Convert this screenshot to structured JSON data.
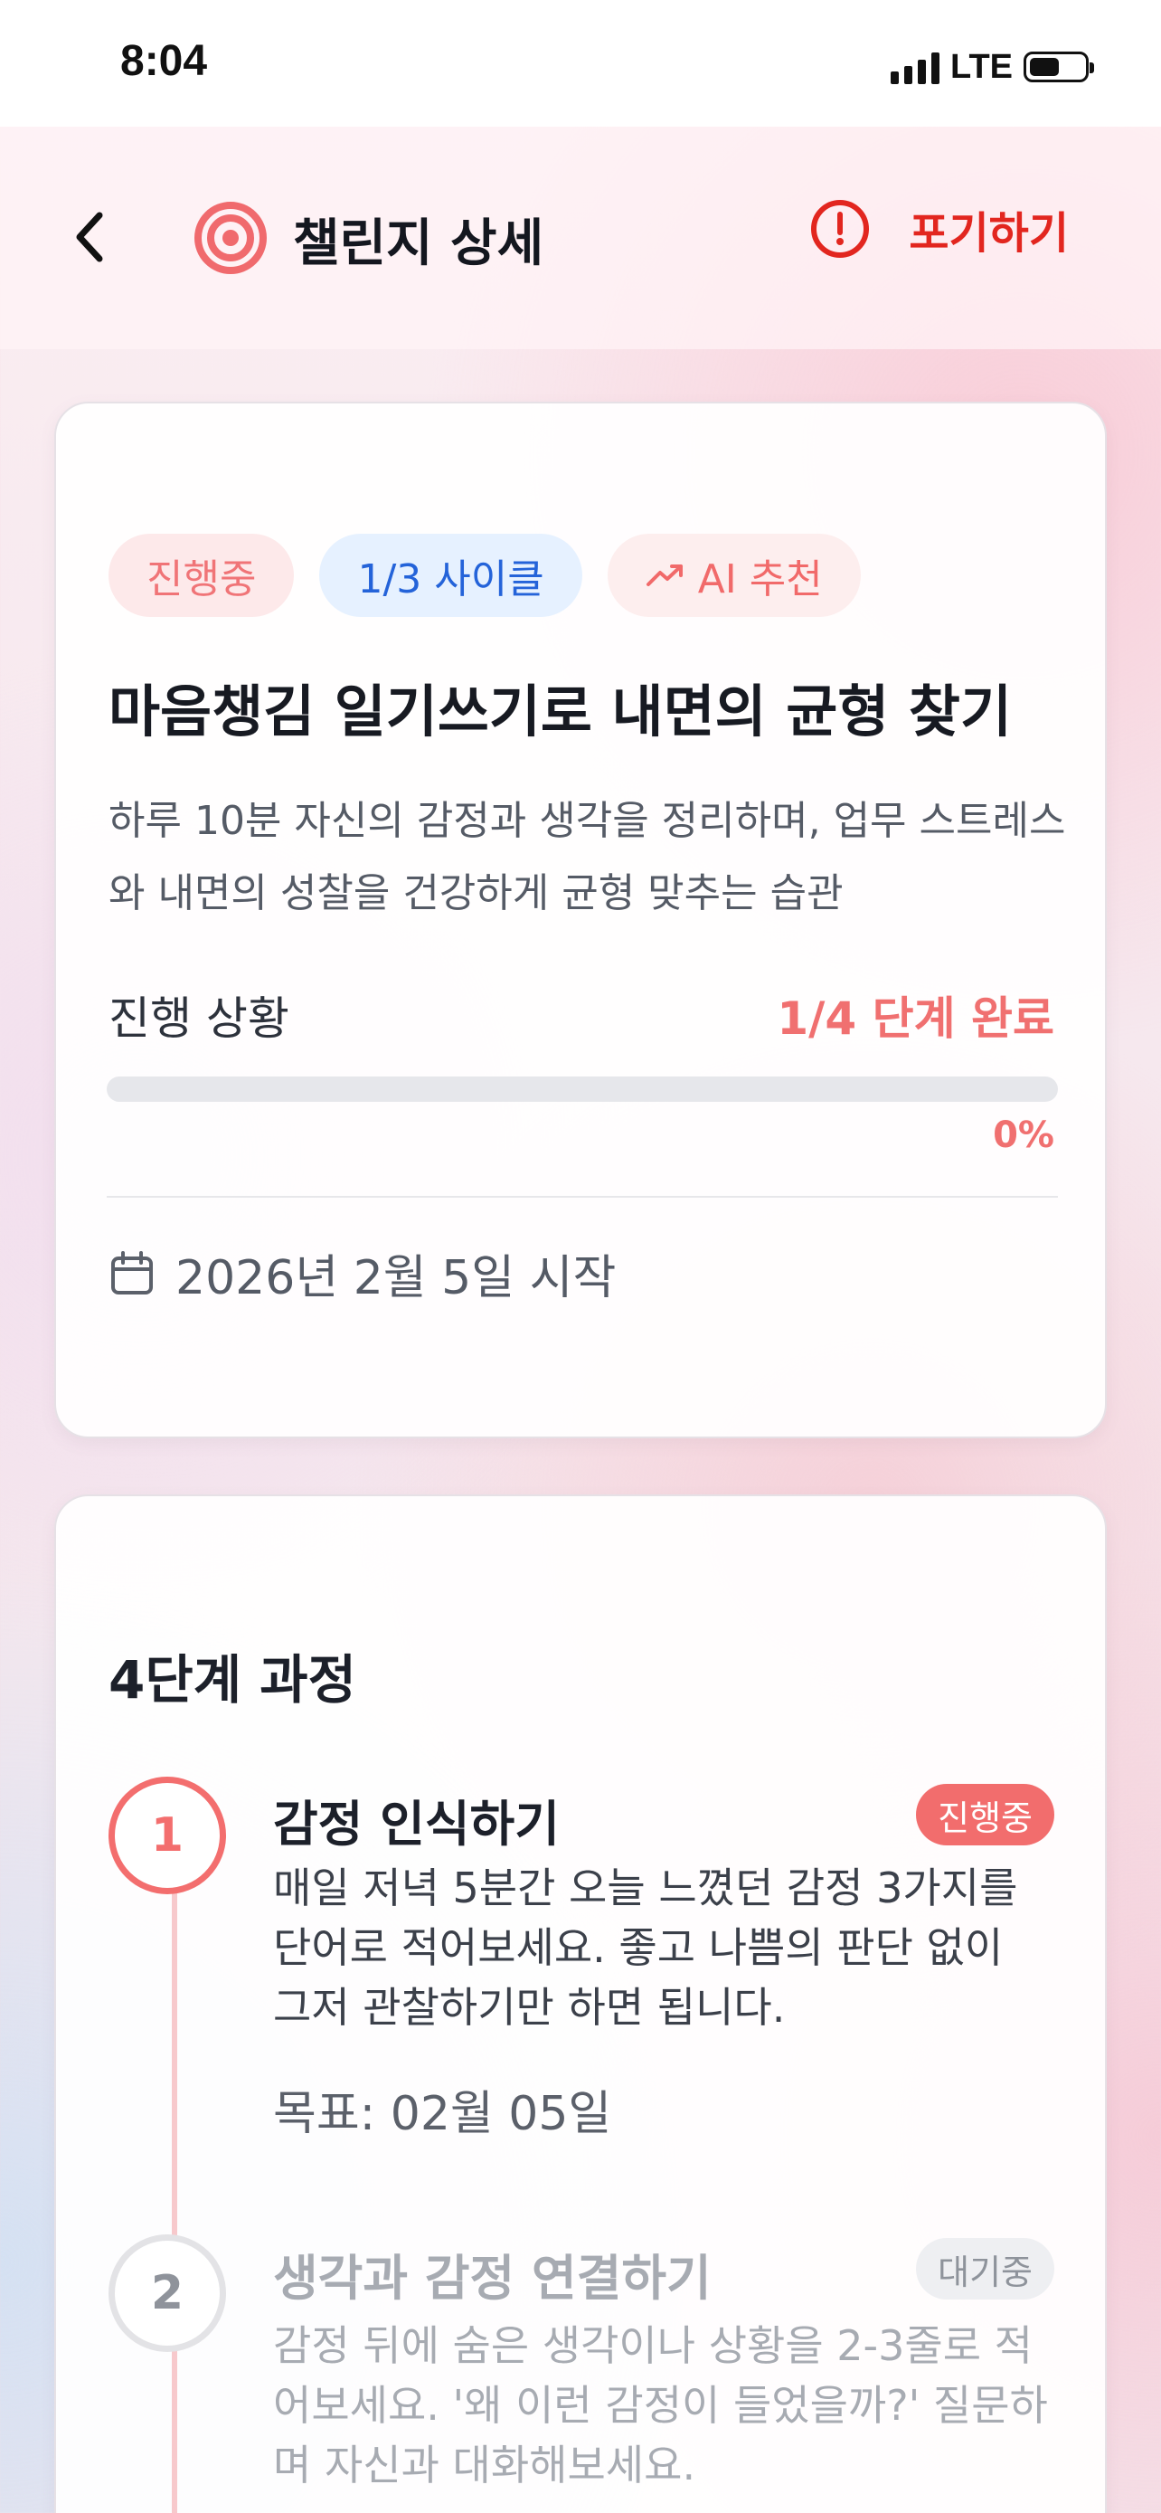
{
  "status_bar": {
    "time": "8:04",
    "network": "LTE",
    "icons": [
      "signal-icon",
      "battery-icon"
    ]
  },
  "header": {
    "title": "챌린지 상세",
    "back_icon": "chevron-left-icon",
    "title_icon": "target-icon",
    "give_up_icon": "alert-circle-icon",
    "give_up_label": "포기하기",
    "accent_color": "#e2261f"
  },
  "challenge": {
    "tags": {
      "status": "진행중",
      "cycle": "1/3 사이클",
      "ai": "AI 추천",
      "ai_icon": "trending-up-icon"
    },
    "title": "마음챙김 일기쓰기로 내면의 균형 찾기",
    "description": "하루 10분 자신의 감정과 생각을 정리하며, 업무 스트레스와 내면의 성찰을 건강하게 균형 맞추는 습관",
    "progress": {
      "label": "진행 상황",
      "steps_text": "1/4 단계 완료",
      "percent_text": "0%",
      "percent": 0
    },
    "start": {
      "icon": "calendar-icon",
      "text": "2026년 2월 5일 시작"
    }
  },
  "steps_section": {
    "title": "4단계 과정",
    "steps": [
      {
        "number": "1",
        "title": "감정 인식하기",
        "badge": "진행중",
        "description": "매일 저녁 5분간 오늘 느꼈던 감정 3가지를 단어로 적어보세요. 좋고 나쁨의 판단 없이 그저 관찰하기만 하면 됩니다.",
        "goal": "목표: 02월 05일"
      },
      {
        "number": "2",
        "title": "생각과 감정 연결하기",
        "badge": "대기중",
        "description": "감정 뒤에 숨은 생각이나 상황을 2-3줄로 적어보세요. '왜 이런 감정이 들었을까?' 질문하며 자신과 대화해보세요."
      }
    ]
  },
  "colors": {
    "primary": "#f36e6e",
    "cycle_blue": "#2463d9",
    "muted": "#a7abb2"
  }
}
